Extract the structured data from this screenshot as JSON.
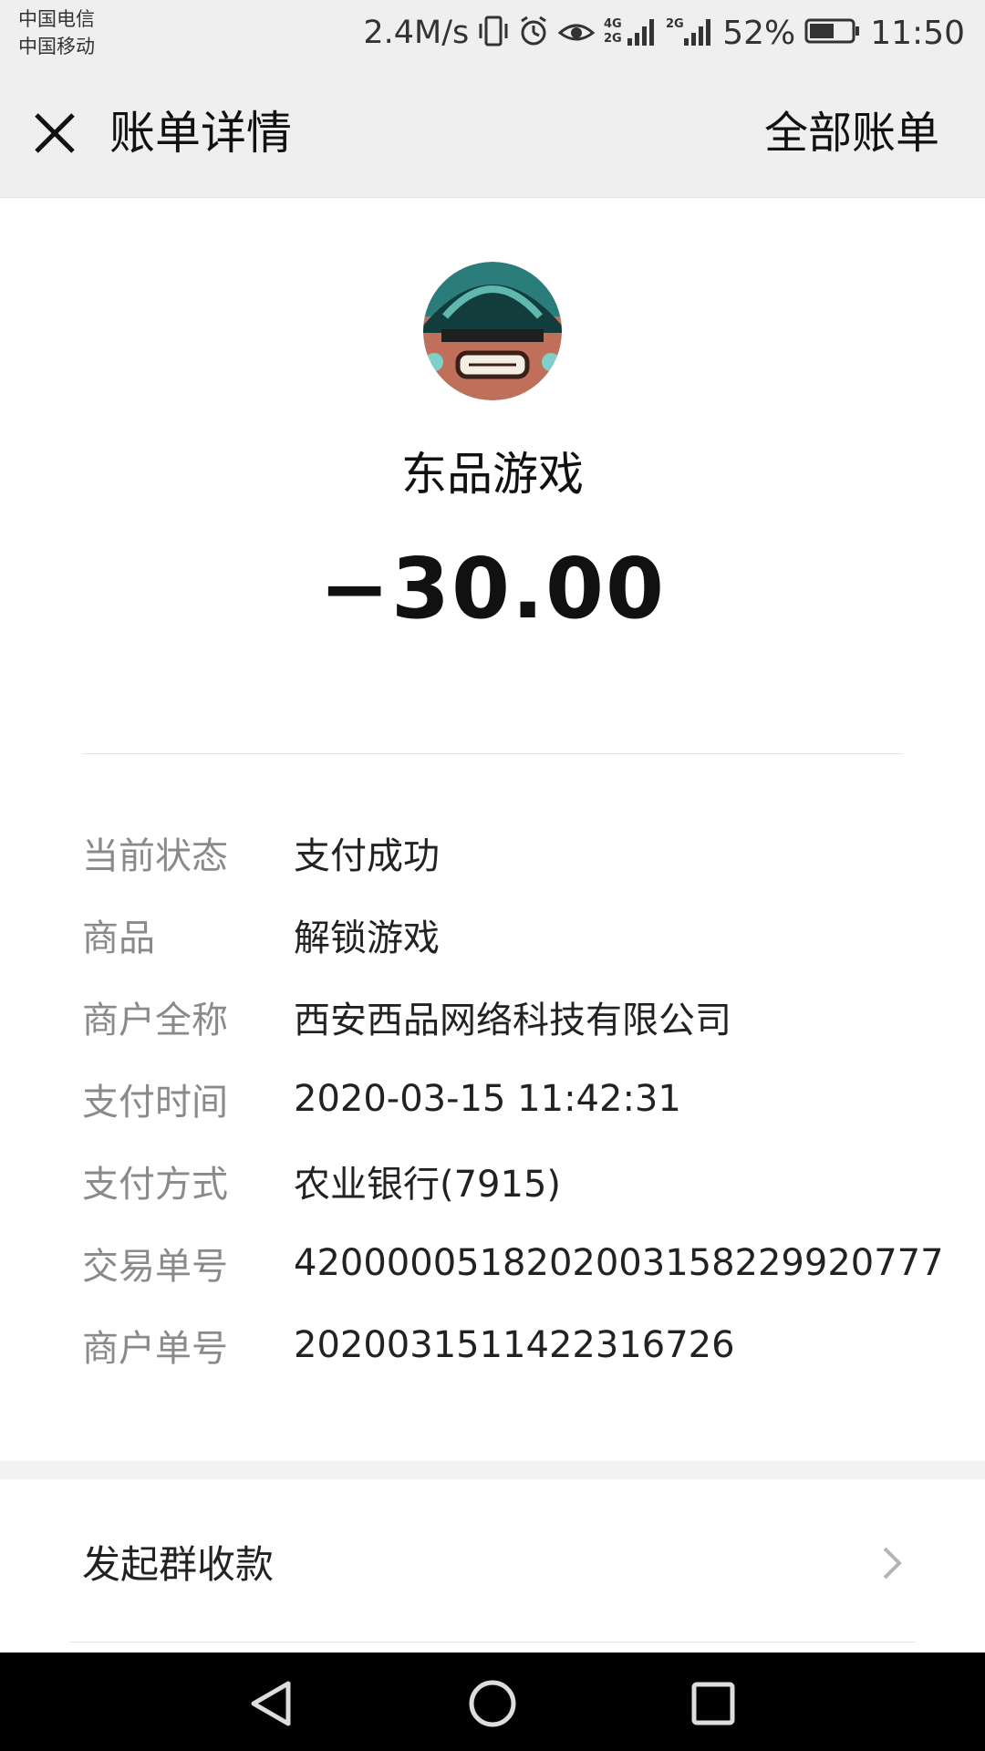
{
  "status_bar": {
    "carrier1": "中国电信",
    "carrier2": "中国移动",
    "net_speed": "2.4M/s",
    "battery": "52%",
    "time": "11:50",
    "icons": [
      "vibrate-icon",
      "alarm-icon",
      "eye-icon",
      "4g-signal-icon",
      "2g-signal-icon",
      "battery-icon"
    ]
  },
  "header": {
    "title": "账单详情",
    "right_action": "全部账单"
  },
  "merchant": {
    "name": "东品游戏",
    "amount": "−30.00"
  },
  "details": [
    {
      "label": "当前状态",
      "value": "支付成功"
    },
    {
      "label": "商品",
      "value": "解锁游戏"
    },
    {
      "label": "商户全称",
      "value": "西安西品网络科技有限公司"
    },
    {
      "label": "支付时间",
      "value": "2020-03-15 11:42:31"
    },
    {
      "label": "支付方式",
      "value": "农业银行(7915)"
    },
    {
      "label": "交易单号",
      "value": "4200000518202003158229920777"
    },
    {
      "label": "商户单号",
      "value": "202003151142231672​6"
    }
  ],
  "actions": {
    "group_collect": "发起群收款"
  },
  "colors": {
    "header_bg": "#efefef",
    "label_gray": "#8a8a8a",
    "navbar_bg": "#000000"
  }
}
